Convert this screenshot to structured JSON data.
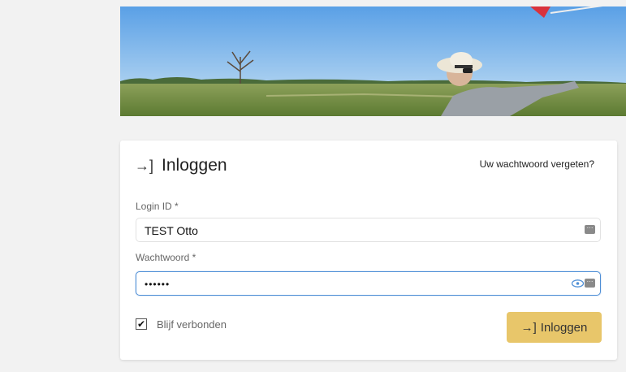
{
  "login": {
    "title": "Inloggen",
    "title_icon": "→]",
    "forgot_link": "Uw wachtwoord vergeten?",
    "login_id_label": "Login ID *",
    "login_id_value": "TEST Otto",
    "password_label": "Wachtwoord *",
    "password_value": "••••••",
    "remember_label": "Blijf verbonden",
    "remember_checked": true,
    "submit_icon": "→]",
    "submit_label": "Inloggen"
  },
  "colors": {
    "page_background": "#f2f2f2",
    "card_background": "#ffffff",
    "button_accent": "#e8c66a",
    "focus_border": "#4f8fd6"
  }
}
